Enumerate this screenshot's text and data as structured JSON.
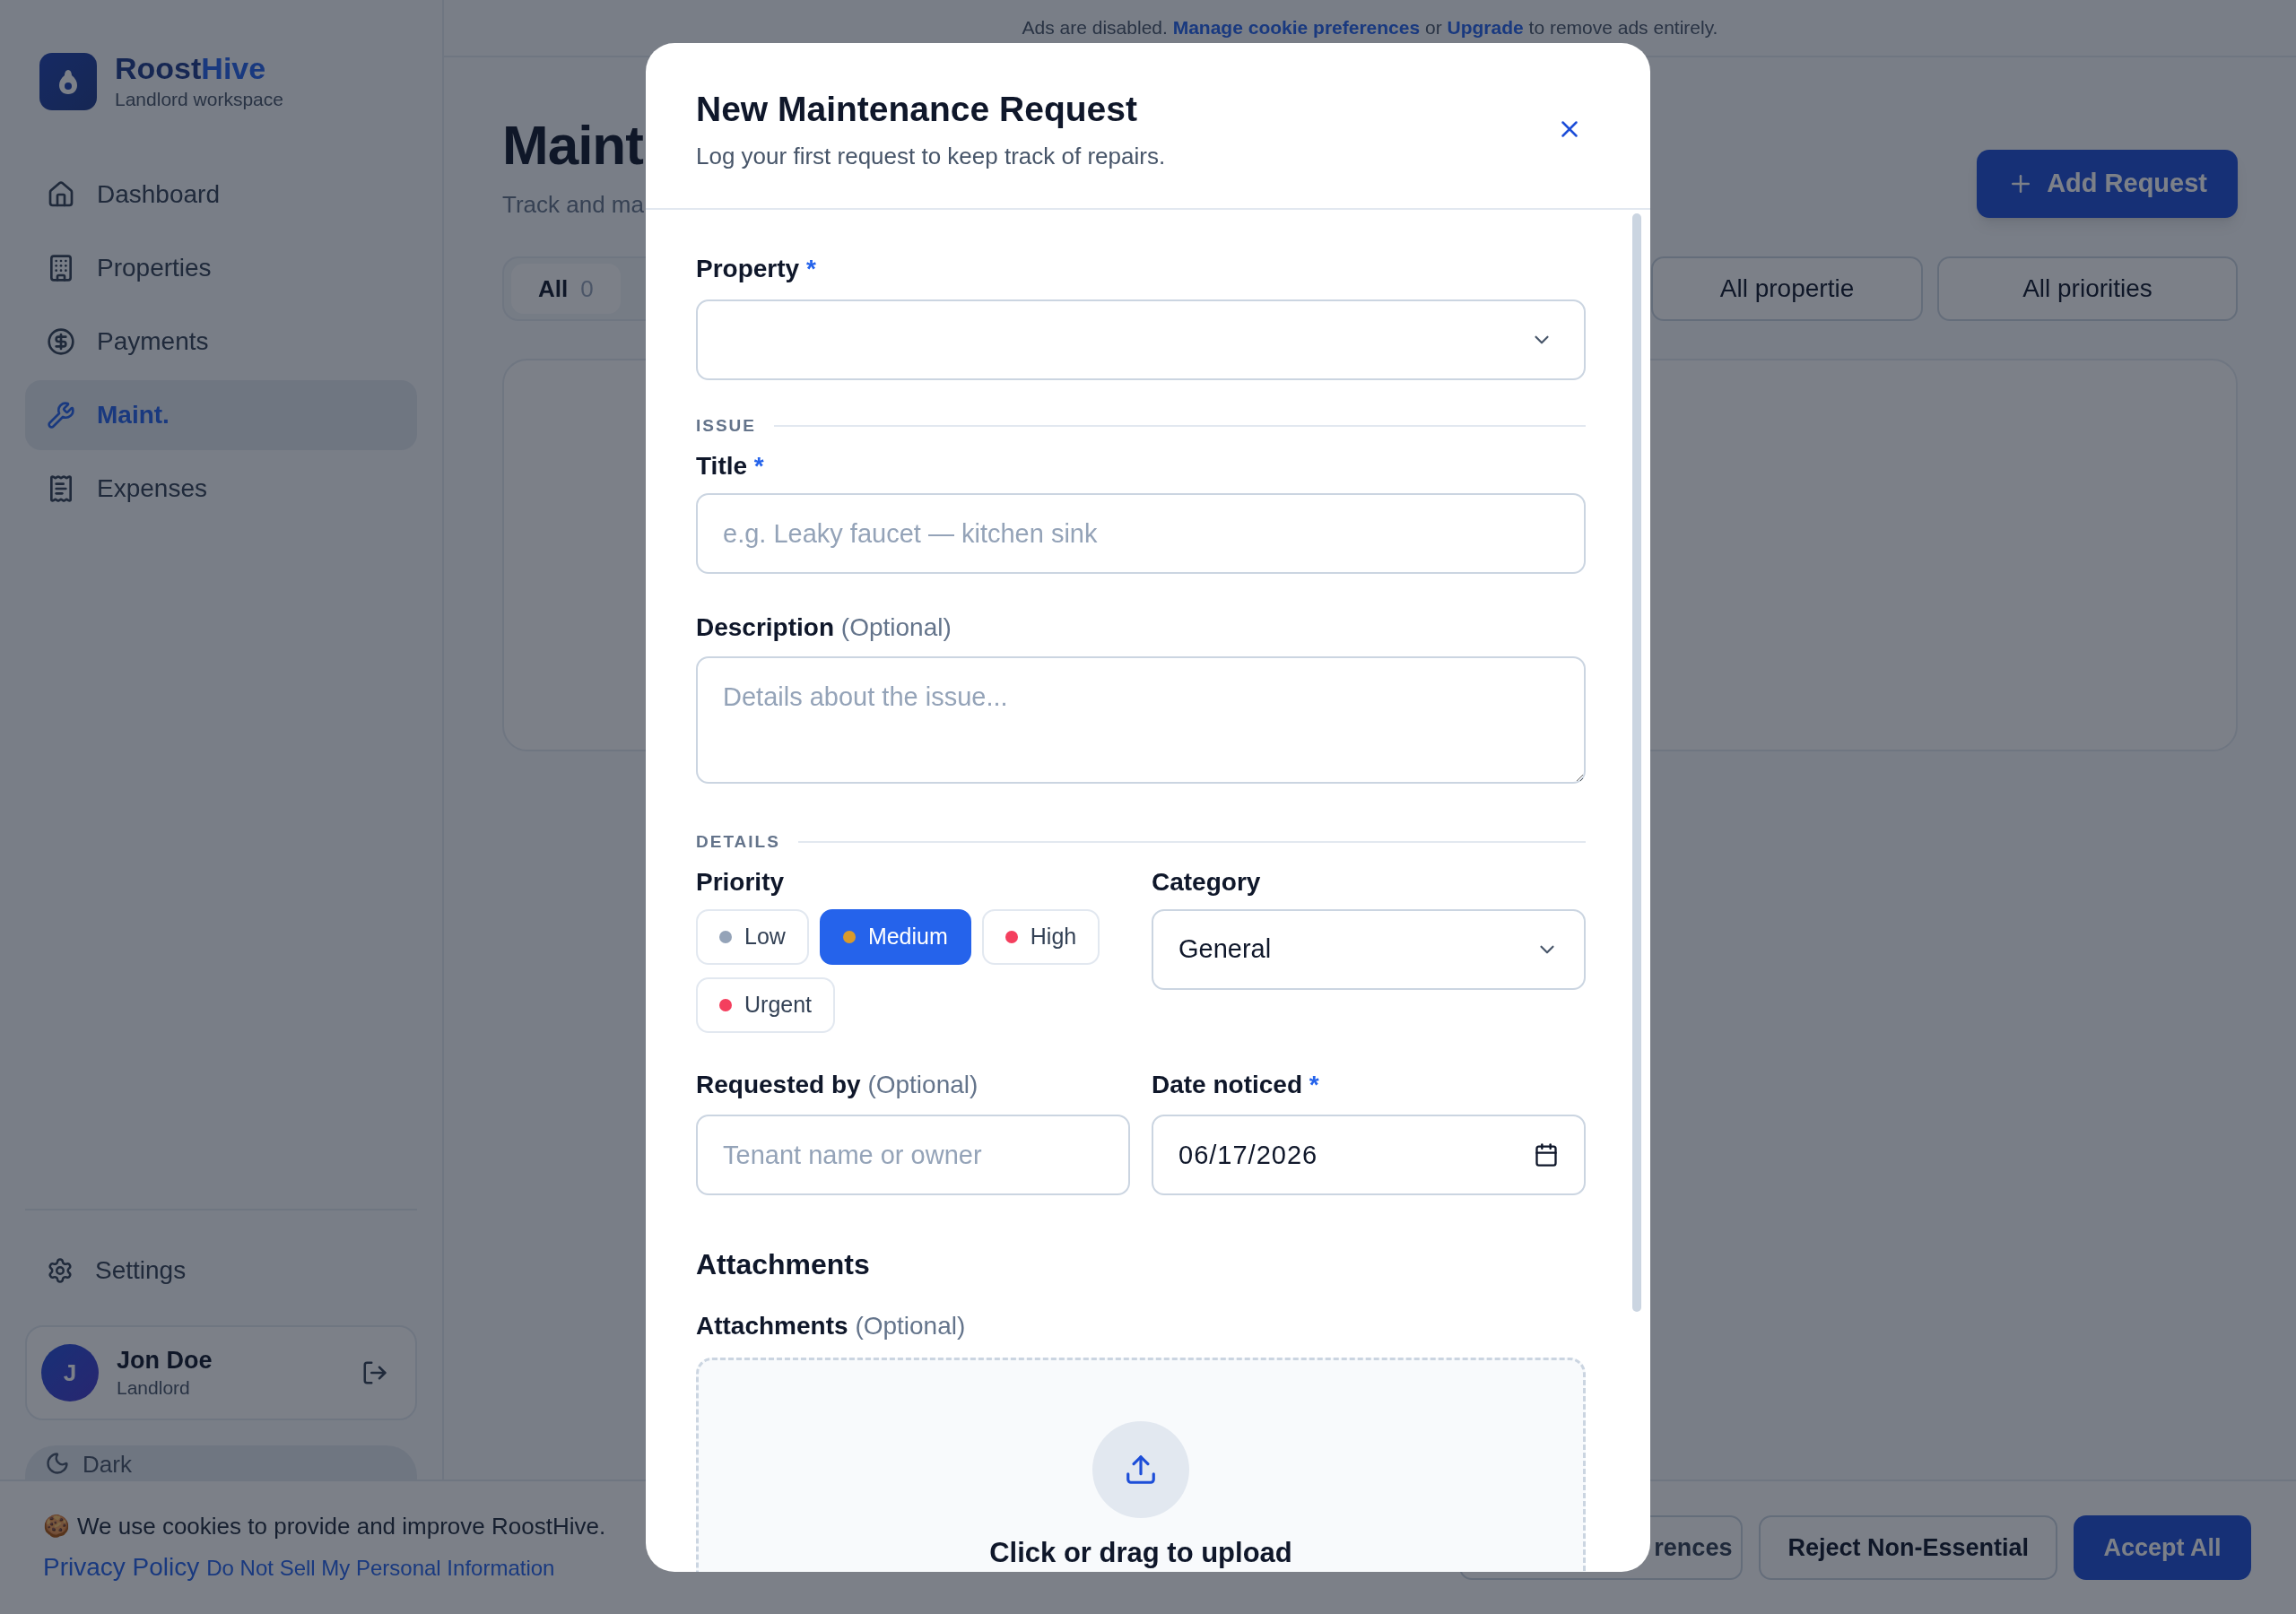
{
  "sidebar": {
    "brand": {
      "first": "Roost",
      "second": "Hive"
    },
    "subtitle": "Landlord workspace",
    "items": [
      {
        "kind": "home",
        "label": "Dashboard",
        "selected": false
      },
      {
        "kind": "building",
        "label": "Properties",
        "selected": false
      },
      {
        "kind": "dollar",
        "label": "Payments",
        "selected": false
      },
      {
        "kind": "wrench",
        "label": "Maint.",
        "selected": true
      },
      {
        "kind": "receipt",
        "label": "Expenses",
        "selected": false
      }
    ],
    "settings": "Settings",
    "user": {
      "initial": "J",
      "name": "Jon Doe",
      "role": "Landlord"
    },
    "theme_button": "Dark"
  },
  "ads_bar": {
    "before": "Ads are disabled.",
    "link1": "Manage cookie preferences",
    "middle": "or",
    "link2": "Upgrade",
    "after": "to remove ads entirely."
  },
  "page": {
    "title": "Maint",
    "subtitle": "Track and ma",
    "add_button": "Add Request",
    "tabs": [
      {
        "label": "All",
        "count": "0",
        "selected": true
      }
    ],
    "filters": [
      "All propertie",
      "All priorities"
    ]
  },
  "modal": {
    "title": "New Maintenance Request",
    "subtitle": "Log your first request to keep track of repairs.",
    "property": {
      "label": "Property",
      "required_mark": "*"
    },
    "issue_heading": "ISSUE",
    "title_field": {
      "label": "Title",
      "required_mark": "*",
      "placeholder": "e.g. Leaky faucet — kitchen sink"
    },
    "description": {
      "label": "Description",
      "optional_note": "(Optional)",
      "placeholder": "Details about the issue..."
    },
    "details_heading": "DETAILS",
    "priority": {
      "label": "Priority",
      "options": [
        {
          "label": "Low",
          "color": "#94a3b8",
          "selected": false
        },
        {
          "label": "Medium",
          "color": "#d99a2b",
          "selected": true
        },
        {
          "label": "High",
          "color": "#f43f5e",
          "selected": false
        },
        {
          "label": "Urgent",
          "color": "#f43f5e",
          "selected": false
        }
      ]
    },
    "category": {
      "label": "Category",
      "value": "General"
    },
    "requested_by": {
      "label": "Requested by",
      "optional_note": "(Optional)",
      "placeholder": "Tenant name or owner"
    },
    "date_noticed": {
      "label": "Date noticed",
      "required_mark": "*",
      "value": "06/17/2026"
    },
    "attachments_heading": "Attachments",
    "attachments": {
      "label": "Attachments",
      "optional_note": "(Optional)",
      "upload_text": "Click or drag to upload"
    }
  },
  "cookie_bar": {
    "emoji": "🍪",
    "text": "We use cookies to provide and improve RoostHive.",
    "privacy_link": "Privacy Policy",
    "do_not_sell_link": "Do Not Sell My Personal Information",
    "buttons": [
      {
        "kind": "outline",
        "label": "rences"
      },
      {
        "kind": "outline",
        "label": "Reject Non-Essential"
      },
      {
        "kind": "primary",
        "label": "Accept All"
      }
    ]
  }
}
